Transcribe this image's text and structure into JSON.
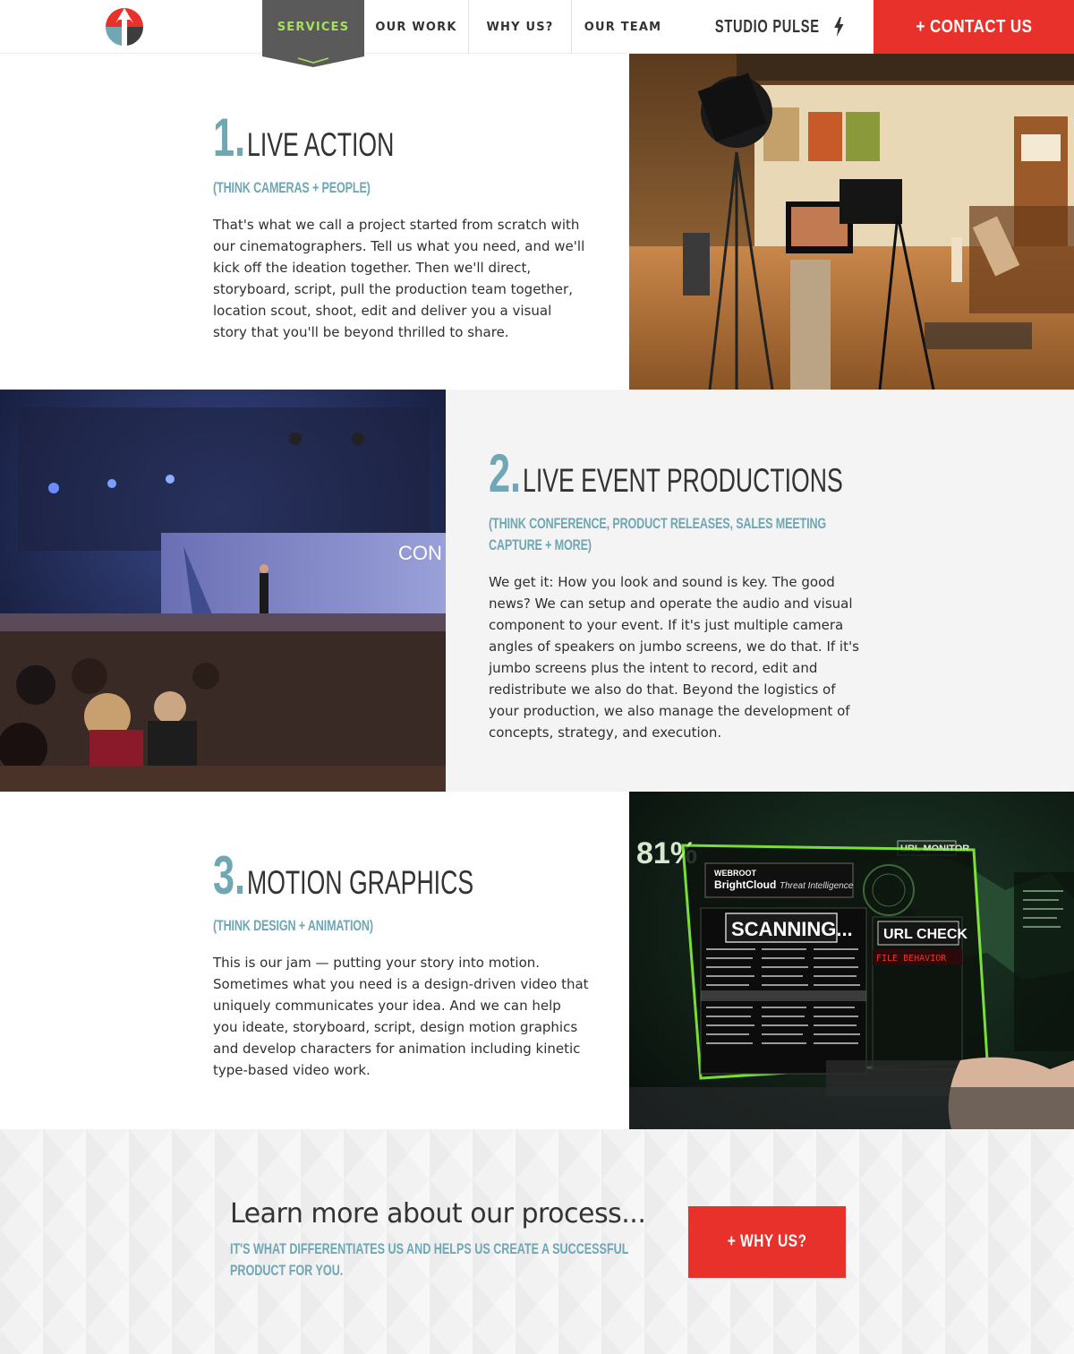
{
  "nav": {
    "items": [
      {
        "label": "SERVICES"
      },
      {
        "label": "OUR WORK"
      },
      {
        "label": "WHY US?"
      },
      {
        "label": "OUR TEAM"
      }
    ],
    "studio_pulse": "STUDIO PULSE",
    "contact": "+ CONTACT US"
  },
  "services": [
    {
      "number": "1.",
      "title": "LIVE ACTION",
      "subtitle": "(THINK CAMERAS + PEOPLE)",
      "body": "That's what we call a project started from scratch with our cinematographers. Tell us what you need, and we'll kick off the ideation together. Then we'll direct, storyboard, script, pull the production team together, location scout, shoot, edit and deliver you a visual story that you'll be beyond thrilled to share."
    },
    {
      "number": "2.",
      "title": "LIVE EVENT PRODUCTIONS",
      "subtitle": "(THINK CONFERENCE, PRODUCT RELEASES, SALES MEETING CAPTURE + MORE)",
      "body": "We get it: How you look and sound is key. The good news? We can setup and operate the audio and visual component to your event. If it's just multiple camera angles of speakers on jumbo screens, we do that. If it's jumbo screens plus the intent to record, edit and redistribute we also do that. Beyond the logistics of your production, we also manage the development of concepts, strategy, and execution."
    },
    {
      "number": "3.",
      "title": "MOTION GRAPHICS",
      "subtitle": "(THINK DESIGN + ANIMATION)",
      "body": "This is our jam — putting your story into motion. Sometimes what you need is a design-driven video that uniquely communicates your idea. And we can help you ideate, storyboard, script, design motion graphics and develop characters for animation including kinetic type-based video work."
    }
  ],
  "images": {
    "event_screen_text": "CON",
    "mg_brand": "WEBROOT",
    "mg_product": "BrightCloud",
    "mg_product_tail": "Threat Intelligence",
    "mg_scanning": "SCANNING...",
    "mg_url_monitor": "URL MONITOR",
    "mg_url_check": "URL CHECK",
    "mg_file_behavior": "FILE BEHAVIOR",
    "mg_percent": "81%"
  },
  "cta": {
    "title": "Learn more about our process...",
    "subtitle": "IT'S WHAT DIFFERENTIATES US AND HELPS US CREATE A SUCCESSFUL PRODUCT FOR YOU.",
    "button": "+ WHY US?"
  },
  "colors": {
    "accent_teal": "#6fa7b4",
    "red": "#e8312a",
    "nav_active_bg": "#5a5a5a",
    "nav_active_text": "#a7e05a"
  }
}
